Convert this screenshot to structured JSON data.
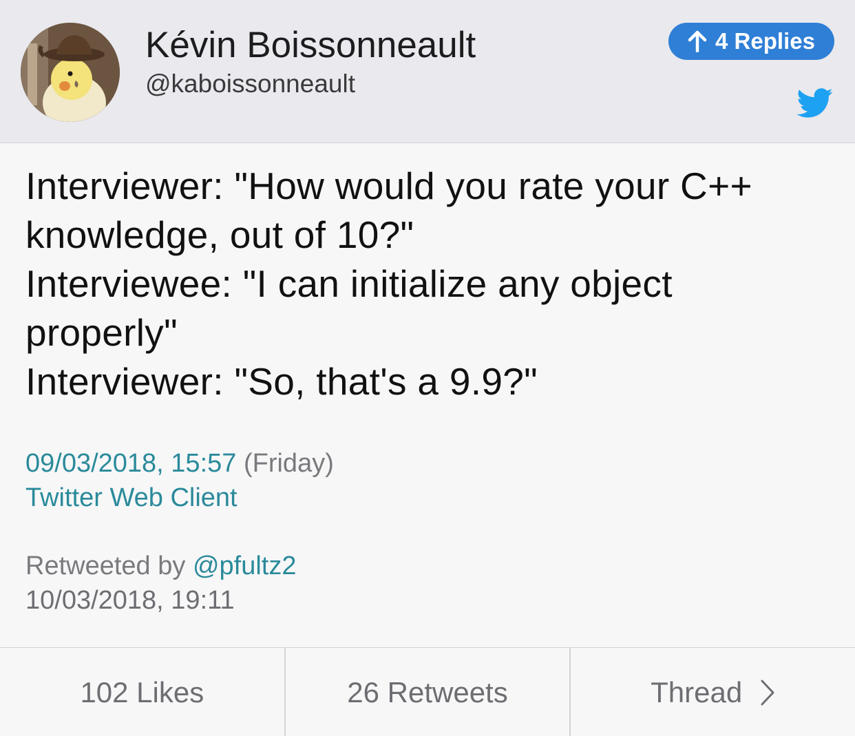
{
  "header": {
    "display_name": "Kévin Boissonneault",
    "handle": "@kaboissonneault",
    "replies_label": "4 Replies",
    "avatar_icon": "avatar-cockatiel-cowboy-hat",
    "brand_icon": "twitter-bird-icon",
    "brand_color": "#1da1f2",
    "replies_color": "#2f7fd6"
  },
  "tweet": {
    "lines": [
      "Interviewer: \"How would you rate your C++",
      "knowledge, out of 10?\"",
      "Interviewee: \"I can initialize any object",
      "properly\"",
      "Interviewer: \"So, that's a 9.9?\""
    ],
    "datetime": "09/03/2018, 15:57",
    "weekday": "(Friday)",
    "client": "Twitter Web Client",
    "link_color": "#2a8a9a"
  },
  "retweet": {
    "prefix": "Retweeted by",
    "user": "@pfultz2",
    "datetime": "10/03/2018, 19:11"
  },
  "footer": {
    "likes": "102 Likes",
    "retweets": "26 Retweets",
    "thread": "Thread"
  }
}
